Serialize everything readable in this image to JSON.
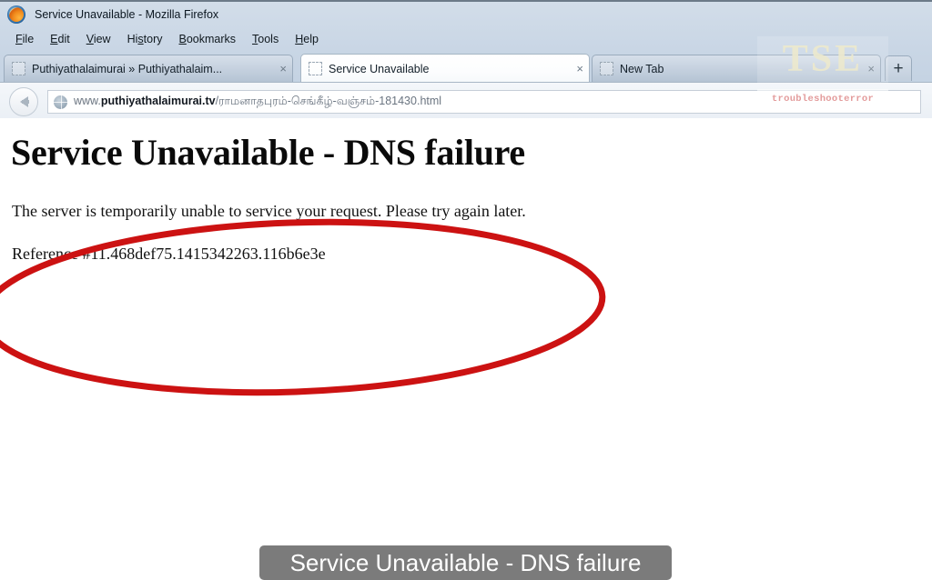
{
  "window": {
    "title": "Service Unavailable - Mozilla Firefox",
    "logo_icon": "firefox-logo"
  },
  "menu": {
    "items": [
      {
        "label": "File"
      },
      {
        "label": "Edit"
      },
      {
        "label": "View"
      },
      {
        "label": "History"
      },
      {
        "label": "Bookmarks"
      },
      {
        "label": "Tools"
      },
      {
        "label": "Help"
      }
    ]
  },
  "tabs": {
    "items": [
      {
        "label": "Puthiyathalaimurai » Puthiyathalaim...",
        "close_label": "×",
        "active": false
      },
      {
        "label": "Service Unavailable",
        "close_label": "×",
        "active": true
      },
      {
        "label": "New Tab",
        "close_label": "×",
        "active": false
      }
    ],
    "new_tab_label": "+"
  },
  "navbar": {
    "back_icon": "back-arrow-icon",
    "site_icon": "globe-icon",
    "url_prefix": "www.",
    "url_host": "puthiyathalaimurai.tv",
    "url_path": "/ராமனாதபுரம்-செங்கீழ்-வஞ்சம்-181430.html"
  },
  "page": {
    "heading": "Service Unavailable - DNS failure",
    "body": "The server is temporarily unable to service your request. Please try again later.",
    "reference": "Reference #11.468def75.1415342263.116b6e3e"
  },
  "annotation": {
    "shape": "ellipse",
    "color": "#cc1212",
    "stroke_width": 7
  },
  "caption": {
    "text": "Service Unavailable - DNS failure",
    "background": "#7b7b7b",
    "color": "#ffffff"
  },
  "watermark": {
    "logo": "TSE",
    "subtitle": "troubleshooterror"
  }
}
